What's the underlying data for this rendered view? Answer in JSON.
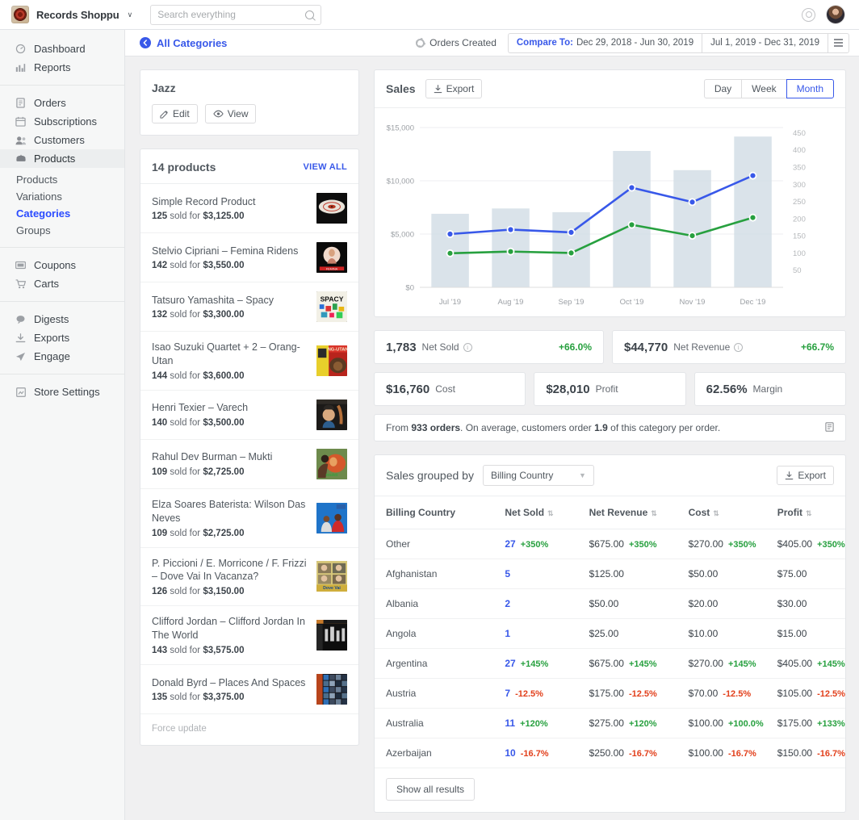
{
  "topbar": {
    "store_name": "Records Shoppu",
    "caret": "∨",
    "search_placeholder": "Search everything",
    "search_value": ""
  },
  "sidebar": {
    "groups": [
      {
        "items": [
          {
            "label": "Dashboard",
            "icon": "dashboard-icon"
          },
          {
            "label": "Reports",
            "icon": "reports-icon"
          }
        ]
      },
      {
        "items": [
          {
            "label": "Orders",
            "icon": "orders-icon"
          },
          {
            "label": "Subscriptions",
            "icon": "subscriptions-icon"
          },
          {
            "label": "Customers",
            "icon": "customers-icon"
          },
          {
            "label": "Products",
            "icon": "products-icon",
            "active": true
          }
        ]
      },
      {
        "subitems": [
          {
            "label": "Products"
          },
          {
            "label": "Variations"
          },
          {
            "label": "Categories",
            "current": true
          },
          {
            "label": "Groups"
          }
        ]
      },
      {
        "items": [
          {
            "label": "Coupons",
            "icon": "coupons-icon"
          },
          {
            "label": "Carts",
            "icon": "carts-icon"
          }
        ]
      },
      {
        "items": [
          {
            "label": "Digests",
            "icon": "digests-icon"
          },
          {
            "label": "Exports",
            "icon": "exports-icon"
          },
          {
            "label": "Engage",
            "icon": "engage-icon"
          }
        ]
      },
      {
        "items": [
          {
            "label": "Store Settings",
            "icon": "store-settings-icon"
          }
        ]
      }
    ]
  },
  "crumbbar": {
    "back_label": "All Categories",
    "orders_created": "Orders Created",
    "compare_prefix": "Compare To:",
    "compare_range": "Dec 29, 2018 - Jun 30, 2019",
    "date_range": "Jul 1, 2019 - Dec 31, 2019"
  },
  "category": {
    "title": "Jazz",
    "edit_label": "Edit",
    "view_label": "View"
  },
  "products_panel": {
    "count_label": "14 products",
    "view_all_label": "VIEW ALL",
    "force_update_label": "Force update",
    "sold_word": "sold for",
    "items": [
      {
        "name": "Simple Record Product",
        "qty": "125",
        "amount": "$3,125.00",
        "art": "record"
      },
      {
        "name": "Stelvio Cipriani – Femina Ridens",
        "qty": "142",
        "amount": "$3,550.00",
        "art": "femina"
      },
      {
        "name": "Tatsuro Yamashita – Spacy",
        "qty": "132",
        "amount": "$3,300.00",
        "art": "spacy"
      },
      {
        "name": "Isao Suzuki Quartet + 2 – Orang-Utan",
        "qty": "144",
        "amount": "$3,600.00",
        "art": "orangutan"
      },
      {
        "name": "Henri Texier – Varech",
        "qty": "140",
        "amount": "$3,500.00",
        "art": "varech"
      },
      {
        "name": "Rahul Dev Burman – Mukti",
        "qty": "109",
        "amount": "$2,725.00",
        "art": "mukti"
      },
      {
        "name": "Elza Soares Baterista: Wilson Das Neves",
        "qty": "109",
        "amount": "$2,725.00",
        "art": "elza"
      },
      {
        "name": "P. Piccioni / E. Morricone / F. Frizzi – Dove Vai In Vacanza?",
        "qty": "126",
        "amount": "$3,150.00",
        "art": "dove"
      },
      {
        "name": "Clifford Jordan – Clifford Jordan In The World",
        "qty": "143",
        "amount": "$3,575.00",
        "art": "clifford"
      },
      {
        "name": "Donald Byrd – Places And Spaces",
        "qty": "135",
        "amount": "$3,375.00",
        "art": "byrd"
      }
    ]
  },
  "sales": {
    "title": "Sales",
    "export_label": "Export",
    "intervals": [
      {
        "label": "Day",
        "active": false
      },
      {
        "label": "Week",
        "active": false
      },
      {
        "label": "Month",
        "active": true
      }
    ]
  },
  "chart_data": {
    "type": "line",
    "title": "Sales",
    "categories": [
      "Jul '19",
      "Aug '19",
      "Sep '19",
      "Oct '19",
      "Nov '19",
      "Dec '19"
    ],
    "bars": {
      "name": "Previous period revenue",
      "values": [
        6900,
        7400,
        7050,
        12800,
        11000,
        14150
      ],
      "color": "#d4dee6"
    },
    "series": [
      {
        "name": "Net Revenue",
        "color": "#3858e9",
        "axis": "right",
        "values": [
          155,
          168,
          160,
          290,
          248,
          325
        ]
      },
      {
        "name": "Net Sold",
        "color": "#27a03f",
        "axis": "right",
        "values": [
          99,
          104,
          100,
          182,
          150,
          203
        ]
      }
    ],
    "ylabel": "",
    "ylim": [
      0,
      15000
    ],
    "y_ticks_left": [
      "$0",
      "$5,000",
      "$10,000",
      "$15,000"
    ],
    "y_ticks_right": [
      "50",
      "100",
      "150",
      "200",
      "250",
      "300",
      "350",
      "400",
      "450"
    ],
    "ylim_right": [
      0,
      465
    ],
    "grid": true,
    "legend": "none"
  },
  "summary": {
    "cards": [
      {
        "value": "1,783",
        "label": "Net Sold",
        "info": true,
        "delta": "+66.0%",
        "positive": true
      },
      {
        "value": "$44,770",
        "label": "Net Revenue",
        "info": true,
        "delta": "+66.7%",
        "positive": true
      },
      {
        "value": "$16,760",
        "label": "Cost",
        "info": false,
        "delta": "",
        "positive": true
      },
      {
        "value": "$28,010",
        "label": "Profit",
        "info": false,
        "delta": "",
        "positive": true
      },
      {
        "value": "62.56%",
        "label": "Margin",
        "info": false,
        "delta": "",
        "positive": true
      }
    ],
    "note_pre": "From ",
    "note_orders": "933 orders",
    "note_mid": ". On average, customers order ",
    "note_avg": "1.9",
    "note_post": " of this category per order."
  },
  "grouped": {
    "title": "Sales grouped by",
    "select_value": "Billing Country",
    "export_label": "Export",
    "show_all_label": "Show all results",
    "columns": [
      "Billing Country",
      "Net Sold",
      "Net Revenue",
      "Cost",
      "Profit"
    ],
    "rows": [
      {
        "country": "Other",
        "sold": "27",
        "sold_d": "+350%",
        "rev": "$675.00",
        "rev_d": "+350%",
        "cost": "$270.00",
        "cost_d": "+350%",
        "profit": "$405.00",
        "profit_d": "+350%"
      },
      {
        "country": "Afghanistan",
        "sold": "5",
        "sold_d": "",
        "rev": "$125.00",
        "rev_d": "",
        "cost": "$50.00",
        "cost_d": "",
        "profit": "$75.00",
        "profit_d": ""
      },
      {
        "country": "Albania",
        "sold": "2",
        "sold_d": "",
        "rev": "$50.00",
        "rev_d": "",
        "cost": "$20.00",
        "cost_d": "",
        "profit": "$30.00",
        "profit_d": ""
      },
      {
        "country": "Angola",
        "sold": "1",
        "sold_d": "",
        "rev": "$25.00",
        "rev_d": "",
        "cost": "$10.00",
        "cost_d": "",
        "profit": "$15.00",
        "profit_d": ""
      },
      {
        "country": "Argentina",
        "sold": "27",
        "sold_d": "+145%",
        "rev": "$675.00",
        "rev_d": "+145%",
        "cost": "$270.00",
        "cost_d": "+145%",
        "profit": "$405.00",
        "profit_d": "+145%"
      },
      {
        "country": "Austria",
        "sold": "7",
        "sold_d": "-12.5%",
        "rev": "$175.00",
        "rev_d": "-12.5%",
        "cost": "$70.00",
        "cost_d": "-12.5%",
        "profit": "$105.00",
        "profit_d": "-12.5%"
      },
      {
        "country": "Australia",
        "sold": "11",
        "sold_d": "+120%",
        "rev": "$275.00",
        "rev_d": "+120%",
        "cost": "$100.00",
        "cost_d": "+100.0%",
        "profit": "$175.00",
        "profit_d": "+133%"
      },
      {
        "country": "Azerbaijan",
        "sold": "10",
        "sold_d": "-16.7%",
        "rev": "$250.00",
        "rev_d": "-16.7%",
        "cost": "$100.00",
        "cost_d": "-16.7%",
        "profit": "$150.00",
        "profit_d": "-16.7%"
      }
    ]
  },
  "colors": {
    "accent": "#3858e9",
    "positive": "#27a03f",
    "negative": "#e2401c",
    "bar": "#d4dee6",
    "line_revenue": "#3858e9",
    "line_sold": "#27a03f"
  }
}
